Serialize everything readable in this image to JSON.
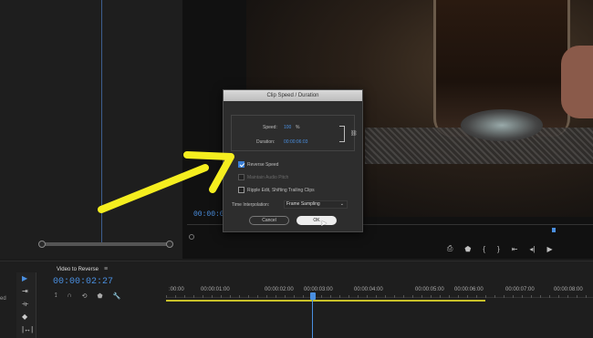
{
  "program": {
    "timecode": "00:00:0",
    "transport": [
      "marker-icon",
      "mark-in-icon",
      "mark-out-icon",
      "go-to-in-icon",
      "step-back-icon",
      "play-icon"
    ]
  },
  "dialog": {
    "title": "Clip Speed / Duration",
    "speed_label": "Speed:",
    "speed_value": "100",
    "speed_unit": "%",
    "duration_label": "Duration:",
    "duration_value": "00:00:06:03",
    "reverse_speed": {
      "label": "Reverse Speed",
      "checked": true
    },
    "maintain_pitch": {
      "label": "Maintain Audio Pitch",
      "checked": false,
      "disabled": true
    },
    "ripple_edit": {
      "label": "Ripple Edit, Shifting Trailing Clips",
      "checked": false
    },
    "interp_label": "Time Interpolation:",
    "interp_value": "Frame Sampling",
    "cancel_label": "Cancel",
    "ok_label": "OK"
  },
  "timeline": {
    "edge_label": "ed",
    "sequence_name": "Video to Reverse",
    "menu_icon": "≡",
    "timecode": "00:00:02:27",
    "ruler_labels": [
      ":00:00",
      "00:00:01:00",
      "00:00:02:00",
      "00:00:03:00",
      "00:00:04:00",
      "00:00:05:00",
      "00:00:06:00",
      "00:00:07:00",
      "00:00:08:00"
    ]
  },
  "colors": {
    "accent": "#4a8fe0",
    "arrow": "#f5ee1f",
    "work_area": "#c8c02a"
  }
}
